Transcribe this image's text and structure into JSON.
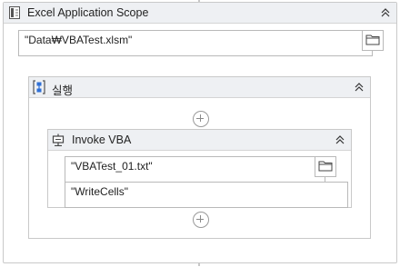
{
  "excel_scope": {
    "title": "Excel Application Scope",
    "workbook_path": "\"Data₩VBATest.xlsm\"",
    "icon": "excel-scope-icon"
  },
  "sequence": {
    "title": "실행",
    "icon": "sequence-icon"
  },
  "invoke_vba": {
    "title": "Invoke VBA",
    "code_file_path": "\"VBATest_01.txt\"",
    "entry_method_name": "\"WriteCells\"",
    "icon": "invoke-vba-icon"
  },
  "colors": {
    "header_bg": "#eef0f3",
    "border": "#c9c9c9",
    "sequence_icon_blue": "#2f6fd6"
  }
}
